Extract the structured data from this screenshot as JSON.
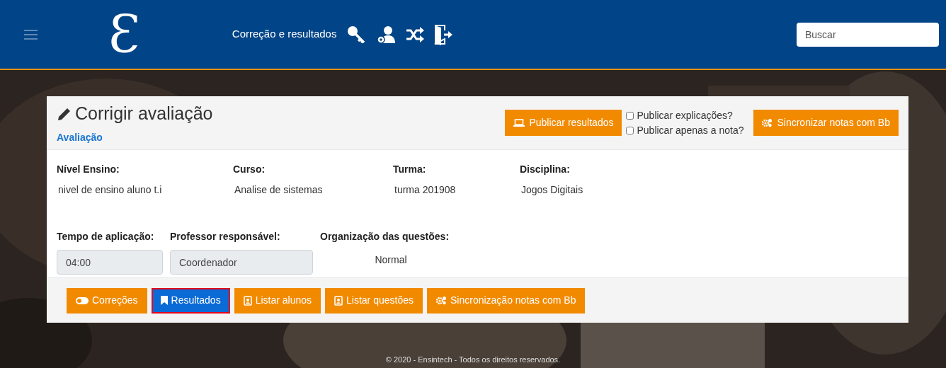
{
  "header": {
    "logo": "Ɛ",
    "title": "Correção e resultados",
    "search": {
      "placeholder": "Buscar"
    }
  },
  "card": {
    "title": "Corrigir avaliação",
    "subtitle": "Avaliação",
    "publish_button": "Publicar resultados",
    "options": [
      {
        "label": "Publicar explicações?",
        "checked": false
      },
      {
        "label": "Publicar apenas a nota?",
        "checked": false
      }
    ],
    "sync_button": "Sincronizar notas com Bb",
    "info": [
      {
        "label": "Nível Ensino:",
        "value": "nivel de ensino aluno t.i"
      },
      {
        "label": "Curso:",
        "value": "Analise de sistemas"
      },
      {
        "label": "Turma:",
        "value": "turma 201908"
      },
      {
        "label": "Disciplina:",
        "value": "Jogos Digitais"
      }
    ],
    "fields": [
      {
        "kind": "input",
        "label": "Tempo de aplicação:",
        "value": "04:00"
      },
      {
        "kind": "input",
        "label": "Professor responsável:",
        "value": "Coordenador"
      },
      {
        "kind": "text",
        "label": "Organização das questões:",
        "value": "Normal"
      }
    ],
    "actions": [
      {
        "kind": "toggle",
        "label": "Correções",
        "selected": false
      },
      {
        "kind": "bookmark",
        "label": "Resultados",
        "selected": true
      },
      {
        "kind": "contact",
        "label": "Listar alunos",
        "selected": false
      },
      {
        "kind": "contact",
        "label": "Listar questões",
        "selected": false
      },
      {
        "kind": "gears",
        "label": "Sincronização notas com Bb",
        "selected": false
      }
    ]
  },
  "footer": "© 2020 - Ensintech - Todos os direitos reservados."
}
